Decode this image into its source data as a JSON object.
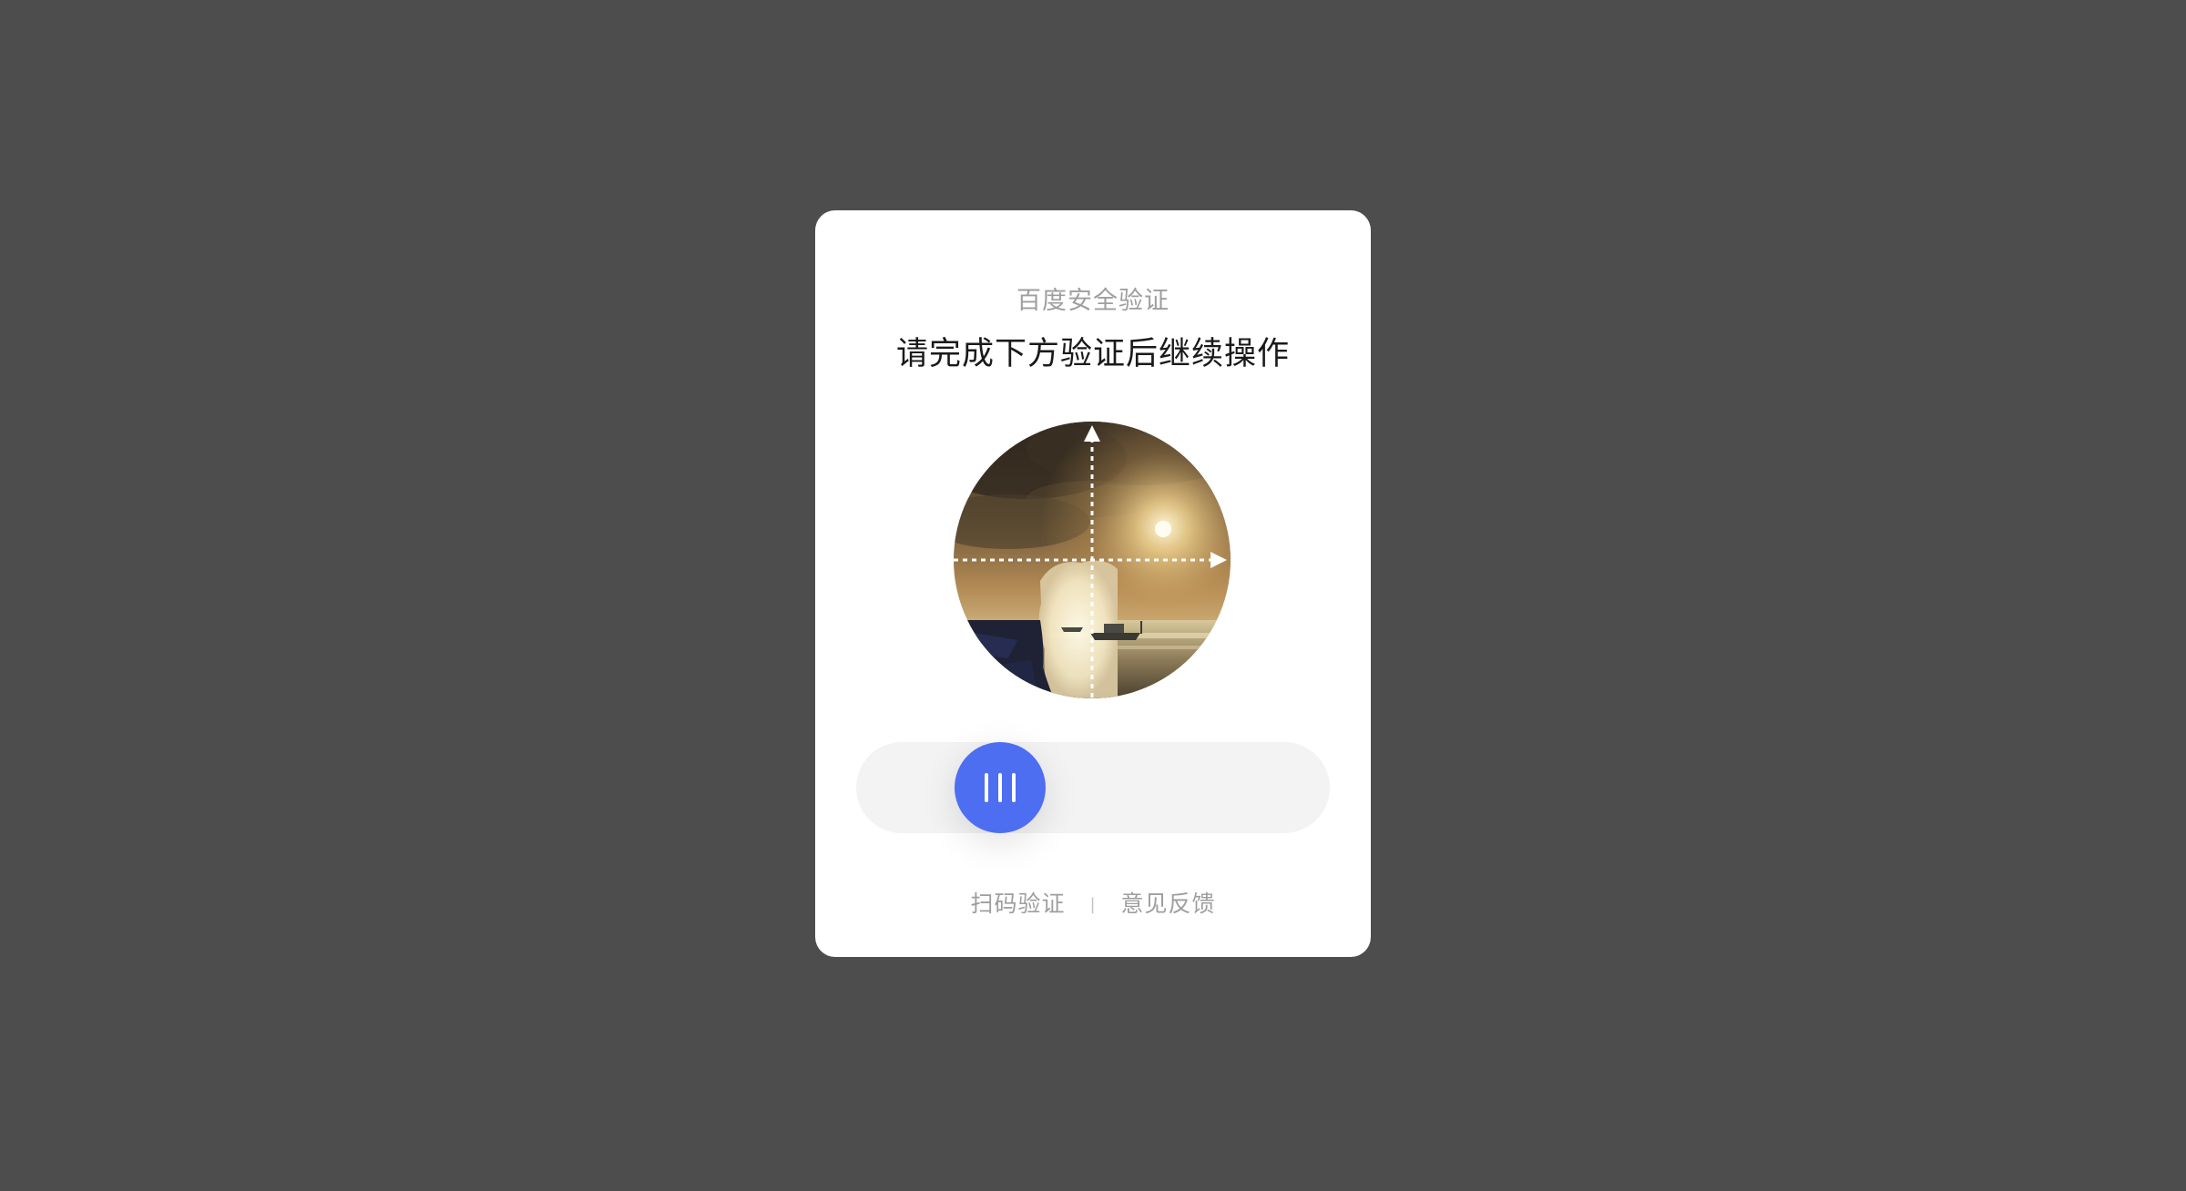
{
  "dialog": {
    "subtitle": "百度安全验证",
    "title": "请完成下方验证后继续操作"
  },
  "captcha": {
    "image_alt": "rotation puzzle photo",
    "handle_icon": "grip-lines-icon",
    "slider_progress": 0.3
  },
  "footer": {
    "scan_label": "扫码验证",
    "separator": "|",
    "feedback_label": "意见反馈"
  },
  "colors": {
    "background": "#4d4d4d",
    "accent": "#4e6ef2",
    "track": "#f3f3f3",
    "muted_text": "#9e9e9e"
  }
}
